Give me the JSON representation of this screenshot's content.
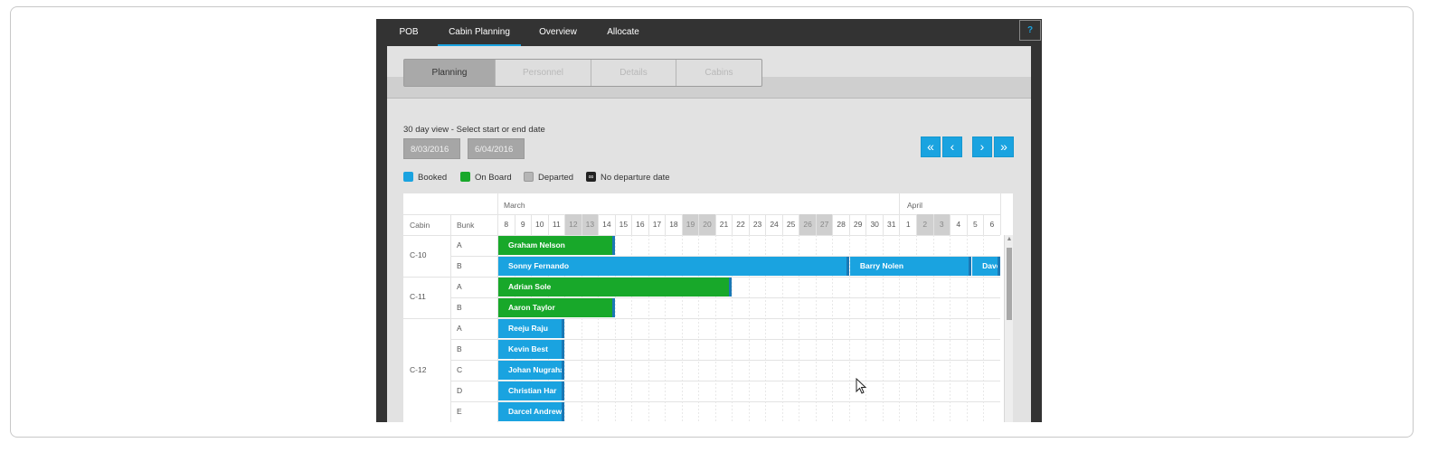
{
  "top_tabs": [
    {
      "label": "POB"
    },
    {
      "label": "Cabin Planning"
    },
    {
      "label": "Overview"
    },
    {
      "label": "Allocate"
    }
  ],
  "help_label": "?",
  "sub_tabs": [
    {
      "label": "Planning"
    },
    {
      "label": "Personnel"
    },
    {
      "label": "Details"
    },
    {
      "label": "Cabins"
    }
  ],
  "date_hint": "30 day view - Select start or end date",
  "start_date": "8/03/2016",
  "end_date": "6/04/2016",
  "nav_buttons": {
    "first": "«",
    "prev": "‹",
    "next": "›",
    "last": "»"
  },
  "legend": [
    {
      "label": "Booked",
      "color": "#1aa3e0",
      "icon": "booked-swatch"
    },
    {
      "label": "On Board",
      "color": "#18a82a",
      "icon": "onboard-swatch"
    },
    {
      "label": "Departed",
      "color": "#b5b5b5",
      "icon": "departed-swatch"
    },
    {
      "label": "No departure date",
      "color": "#222222",
      "icon": "infinity-icon"
    }
  ],
  "grid": {
    "col_cabin": "Cabin",
    "col_bunk": "Bunk",
    "months": [
      {
        "label": "March"
      },
      {
        "label": "April"
      }
    ],
    "days": [
      {
        "d": "8"
      },
      {
        "d": "9"
      },
      {
        "d": "10"
      },
      {
        "d": "11"
      },
      {
        "d": "12",
        "weekend": true
      },
      {
        "d": "13",
        "weekend": true
      },
      {
        "d": "14"
      },
      {
        "d": "15"
      },
      {
        "d": "16"
      },
      {
        "d": "17"
      },
      {
        "d": "18"
      },
      {
        "d": "19",
        "weekend": true
      },
      {
        "d": "20",
        "weekend": true
      },
      {
        "d": "21"
      },
      {
        "d": "22"
      },
      {
        "d": "23"
      },
      {
        "d": "24"
      },
      {
        "d": "25"
      },
      {
        "d": "26",
        "weekend": true
      },
      {
        "d": "27",
        "weekend": true
      },
      {
        "d": "28"
      },
      {
        "d": "29"
      },
      {
        "d": "30"
      },
      {
        "d": "31"
      },
      {
        "d": "1"
      },
      {
        "d": "2",
        "weekend": true
      },
      {
        "d": "3",
        "weekend": true
      },
      {
        "d": "4"
      },
      {
        "d": "5"
      },
      {
        "d": "6"
      }
    ],
    "cabins": [
      {
        "name": "C-10",
        "bunks": [
          "A",
          "B"
        ]
      },
      {
        "name": "C-11",
        "bunks": [
          "A",
          "B"
        ]
      },
      {
        "name": "C-12",
        "bunks": [
          "A",
          "B",
          "C",
          "D",
          "E"
        ]
      }
    ],
    "bookings": [
      {
        "name": "Graham Nelson",
        "status": "onboard",
        "row": 0,
        "start": 0,
        "days": 7
      },
      {
        "name": "Sonny Fernando",
        "status": "booked",
        "row": 1,
        "start": 0,
        "days": 21
      },
      {
        "name": "Barry Nolen",
        "status": "booked",
        "row": 1,
        "start": 21,
        "days": 7.3
      },
      {
        "name": "Dave W",
        "status": "booked",
        "row": 1,
        "start": 28.3,
        "days": 1.9
      },
      {
        "name": "Adrian Sole",
        "status": "onboard",
        "row": 2,
        "start": 0,
        "days": 14
      },
      {
        "name": "Aaron Taylor",
        "status": "onboard",
        "row": 3,
        "start": 0,
        "days": 7
      },
      {
        "name": "Reeju Raju",
        "status": "booked",
        "row": 4,
        "start": 0,
        "days": 4
      },
      {
        "name": "Kevin Best",
        "status": "booked",
        "row": 5,
        "start": 0,
        "days": 4
      },
      {
        "name": "Johan Nugraha",
        "status": "booked",
        "row": 6,
        "start": 0,
        "days": 4
      },
      {
        "name": "Christian Har",
        "status": "booked",
        "row": 7,
        "start": 0,
        "days": 4
      },
      {
        "name": "Darcel Andrew",
        "status": "booked",
        "row": 8,
        "start": 0,
        "days": 4
      }
    ]
  }
}
